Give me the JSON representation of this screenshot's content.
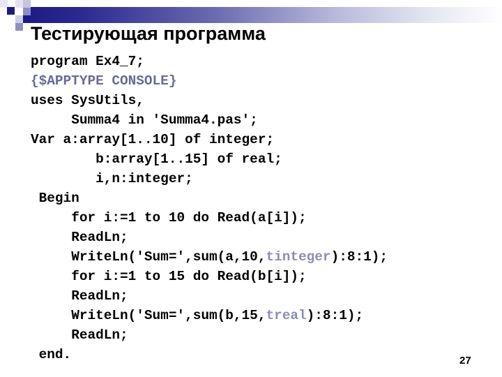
{
  "slide": {
    "title": "Тестирующая программа",
    "page_number": "27",
    "colors": {
      "accent_bar": "#1c1a86",
      "directive": "#6a6a98",
      "type_param": "#8e8eb4",
      "text": "#000000"
    }
  },
  "code": {
    "lines": [
      {
        "indent": "",
        "parts": [
          {
            "text": "program Ex4_7;",
            "style": "normal"
          }
        ]
      },
      {
        "indent": "",
        "parts": [
          {
            "text": "{$APPTYPE CONSOLE}",
            "style": "directive"
          }
        ]
      },
      {
        "indent": "",
        "parts": [
          {
            "text": "uses SysUtils,",
            "style": "normal"
          }
        ]
      },
      {
        "indent": "     ",
        "parts": [
          {
            "text": "Summa4 in 'Summa4.pas';",
            "style": "normal"
          }
        ]
      },
      {
        "indent": "",
        "parts": [
          {
            "text": "Var a:array[1..10] of integer;",
            "style": "normal"
          }
        ]
      },
      {
        "indent": "        ",
        "parts": [
          {
            "text": "b:array[1..15] of real;",
            "style": "normal"
          }
        ]
      },
      {
        "indent": "        ",
        "parts": [
          {
            "text": "i,n:integer;",
            "style": "normal"
          }
        ]
      },
      {
        "indent": " ",
        "parts": [
          {
            "text": "Begin",
            "style": "normal"
          }
        ]
      },
      {
        "indent": "     ",
        "parts": [
          {
            "text": "for i:=1 to 10 do Read(a[i]);",
            "style": "normal"
          }
        ]
      },
      {
        "indent": "     ",
        "parts": [
          {
            "text": "ReadLn;",
            "style": "normal"
          }
        ]
      },
      {
        "indent": "     ",
        "parts": [
          {
            "text": "WriteLn('Sum=',sum(a,10,",
            "style": "normal"
          },
          {
            "text": "tinteger",
            "style": "typename"
          },
          {
            "text": "):8:1);",
            "style": "normal"
          }
        ]
      },
      {
        "indent": "     ",
        "parts": [
          {
            "text": "for i:=1 to 15 do Read(b[i]);",
            "style": "normal"
          }
        ]
      },
      {
        "indent": "     ",
        "parts": [
          {
            "text": "ReadLn;",
            "style": "normal"
          }
        ]
      },
      {
        "indent": "     ",
        "parts": [
          {
            "text": "WriteLn('Sum=',sum(b,15,",
            "style": "normal"
          },
          {
            "text": "treal",
            "style": "typename"
          },
          {
            "text": "):8:1);",
            "style": "normal"
          }
        ]
      },
      {
        "indent": "     ",
        "parts": [
          {
            "text": "ReadLn;",
            "style": "normal"
          }
        ]
      },
      {
        "indent": " ",
        "parts": [
          {
            "text": "end.",
            "style": "normal"
          }
        ]
      }
    ]
  }
}
